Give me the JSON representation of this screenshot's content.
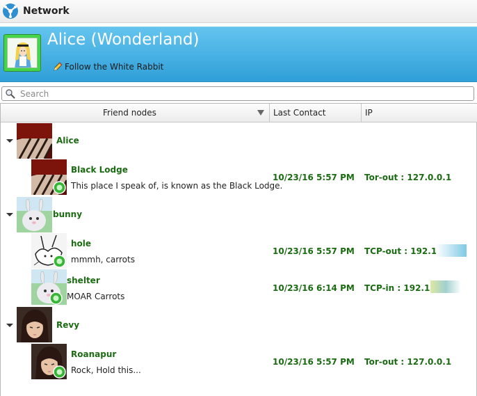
{
  "window": {
    "title": "Network"
  },
  "profile": {
    "name": "Alice (Wonderland)",
    "status": "Follow the White Rabbit"
  },
  "search": {
    "placeholder": "Search"
  },
  "columns": {
    "friend_nodes": "Friend nodes",
    "last_contact": "Last Contact",
    "ip": "IP"
  },
  "groups": [
    {
      "name": "Alice",
      "nodes": [
        {
          "name": "Black Lodge",
          "status": "This place I speak of, is known as the Black Lodge.",
          "last_contact": "10/23/16 5:57 PM",
          "ip": "Tor-out : 127.0.0.1"
        }
      ]
    },
    {
      "name": "bunny",
      "nodes": [
        {
          "name": "hole",
          "status": "mmmh, carrots",
          "last_contact": "10/23/16 5:57 PM",
          "ip": "TCP-out : 192.168."
        },
        {
          "name": "shelter",
          "status": "MOAR Carrots",
          "last_contact": "10/23/16 6:14 PM",
          "ip": "TCP-in : 192.168."
        }
      ]
    },
    {
      "name": "Revy",
      "nodes": [
        {
          "name": "Roanapur",
          "status": "Rock, Hold this...",
          "last_contact": "10/23/16 5:57 PM",
          "ip": "Tor-out : 127.0.0.1"
        }
      ]
    }
  ],
  "colors": {
    "header_bg": "#2f9fd8",
    "node_name": "#1b6b12",
    "online": "#36b536",
    "avatar_frame": "#47d44a"
  }
}
